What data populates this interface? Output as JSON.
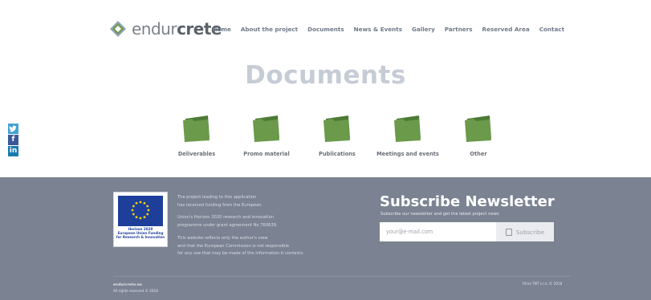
{
  "header": {
    "logo": {
      "text_a": "endur",
      "text_b": "crete"
    },
    "nav": [
      "Home",
      "About the project",
      "Documents",
      "News & Events",
      "Gallery",
      "Partners",
      "Reserved Area",
      "Contact"
    ]
  },
  "main": {
    "title": "Documents",
    "folders": [
      {
        "label": "Deliverables"
      },
      {
        "label": "Promo material"
      },
      {
        "label": "Publications"
      },
      {
        "label": "Meetings and events"
      },
      {
        "label": "Other"
      }
    ],
    "folder_color": "#6a9a4a"
  },
  "social": [
    "twitter",
    "facebook",
    "linkedin"
  ],
  "footer": {
    "eu_logo_text": [
      "Horizon 2020",
      "European Union Funding",
      "for Research & Innovation"
    ],
    "funding_text": [
      [
        "The project leading to this application",
        "has received funding from the European"
      ],
      [
        "Union's Horizon 2020 research and innovation",
        "programme under grant agreement No 760639."
      ],
      [
        "This website reflects only the author's view",
        "and that the European Commission is not responsible",
        "for any use that may be made of the information it contains."
      ]
    ],
    "newsletter": {
      "title": "Subscribe Newsletter",
      "subtitle": "Subscribe our newsletter and get the latest project news",
      "email_placeholder": "your@e-mail.com",
      "button_label": "Subscribe"
    },
    "copyright_site": "endurcrete.eu",
    "copyright_rights": "All rights reserved © 2018",
    "copyright_right": "Filine TNT s.r.o. © 2018"
  },
  "colors": {
    "footer_bg": "#7b8392",
    "title": "#c6ccd6",
    "folder": "#6a9a4a"
  }
}
